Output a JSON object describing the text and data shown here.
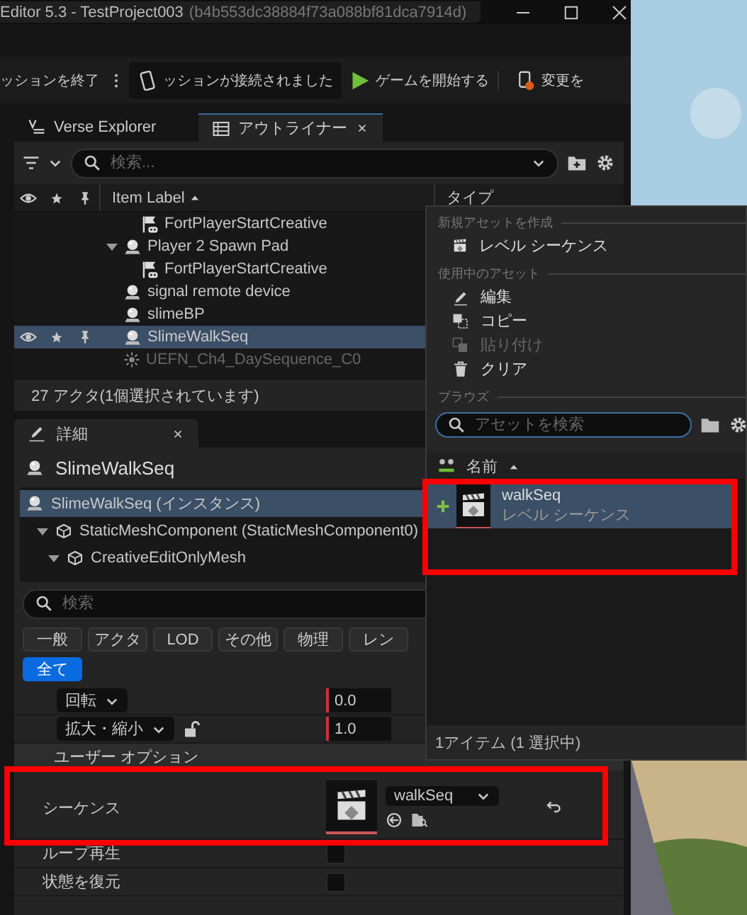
{
  "window": {
    "title": "Editor 5.3 - TestProject003",
    "project_id": "(b4b553dc38884f73a088bf81dca7914d)"
  },
  "toolbar": {
    "end_session": "ッションを終了",
    "session_status": "ッションが接続されました",
    "start_game": "ゲームを開始する",
    "push_changes": "変更を"
  },
  "panel_tabs": [
    {
      "label": "Verse Explorer",
      "selected": false
    },
    {
      "label": "アウトライナー",
      "selected": true
    }
  ],
  "outliner": {
    "search": {
      "placeholder": "検索..."
    },
    "columns": [
      {
        "label": "Item Label"
      },
      {
        "label": "タイプ"
      }
    ],
    "tree": [
      {
        "children": [
          {
            "label": "FortPlayerStartCreative",
            "kind": "player_start",
            "selected": false
          }
        ]
      },
      {
        "label": "Player 2 Spawn Pad",
        "kind": "device",
        "selected": false,
        "expanded": true,
        "children": [
          {
            "label": "FortPlayerStartCreative",
            "kind": "player_start",
            "selected": false
          }
        ]
      },
      {
        "label": "signal remote device",
        "kind": "device",
        "selected": false
      },
      {
        "label": "slimeBP",
        "kind": "device",
        "selected": false
      },
      {
        "label": "SlimeWalkSeq",
        "kind": "device",
        "selected": true
      },
      {
        "label": "UEFN_Ch4_DaySequence_C0",
        "kind": "sequence",
        "selected": false
      }
    ],
    "status": "27 アクタ(1個選択されています)"
  },
  "details": {
    "tab": "詳細",
    "title": "SlimeWalkSeq",
    "components": [
      {
        "label": "SlimeWalkSeq (インスタンス)",
        "kind": "actor",
        "selected": true,
        "children": [
          {
            "label": "StaticMeshComponent (StaticMeshComponent0)",
            "kind": "mesh",
            "selected": false,
            "expanded": true,
            "children": [
              {
                "label": "CreativeEditOnlyMesh",
                "kind": "mesh",
                "selected": false,
                "expanded": true
              }
            ]
          }
        ]
      }
    ],
    "search": {
      "placeholder": "検索"
    },
    "filters": [
      {
        "label": "一般",
        "selected": false
      },
      {
        "label": "アクタ",
        "selected": false
      },
      {
        "label": "LOD",
        "selected": false
      },
      {
        "label": "その他",
        "selected": false
      },
      {
        "label": "物理",
        "selected": false
      },
      {
        "label": "レン",
        "selected": false
      }
    ],
    "all_filter": {
      "label": "全て",
      "selected": true
    },
    "properties": [
      {
        "kind": "transform",
        "label": "回転",
        "value": "0.0"
      },
      {
        "kind": "transform",
        "label": "拡大・縮小",
        "value": "1.0",
        "lock": true
      },
      {
        "kind": "section",
        "label": "ユーザー オプション"
      },
      {
        "kind": "asset",
        "label": "シーケンス",
        "value": "walkSeq"
      },
      {
        "kind": "checkbox",
        "label": "ループ再生",
        "checked": false
      },
      {
        "kind": "checkbox",
        "label": "状態を復元",
        "checked": false
      }
    ]
  },
  "asset_menu": {
    "sections": [
      {
        "heading": "新規アセットを作成",
        "items": [
          {
            "label": "レベル シーケンス",
            "kind": "sequence",
            "disabled": false
          }
        ]
      },
      {
        "heading": "使用中のアセット",
        "items": [
          {
            "label": "編集",
            "kind": "edit",
            "disabled": false
          },
          {
            "label": "コピー",
            "kind": "copy",
            "disabled": false
          },
          {
            "label": "貼り付け",
            "kind": "paste",
            "disabled": true
          },
          {
            "label": "クリア",
            "kind": "clear",
            "disabled": false
          }
        ]
      }
    ],
    "browse": {
      "heading": "ブラウズ",
      "search": {
        "placeholder": "アセットを検索"
      },
      "column": "名前",
      "assets": [
        {
          "name": "walkSeq",
          "type": "レベル シーケンス",
          "selected": true
        }
      ],
      "status": "1アイテム (1 選択中)"
    }
  }
}
